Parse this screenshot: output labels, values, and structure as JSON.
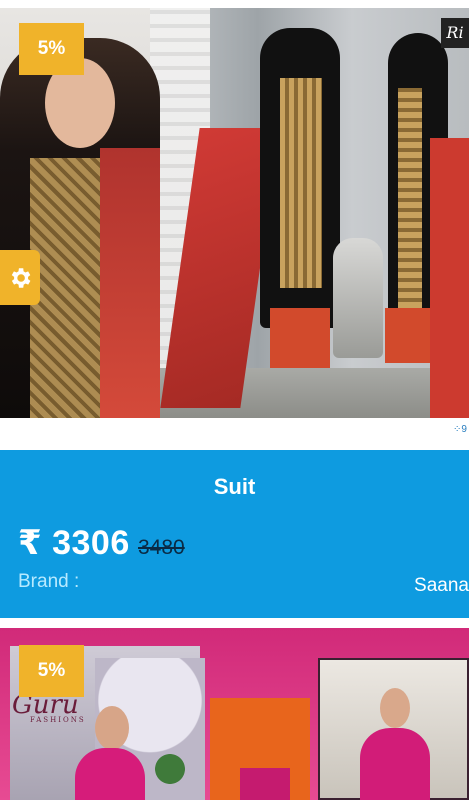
{
  "product1": {
    "discount_badge": "5%",
    "photo_logo_text": "Ri",
    "watermark_text": "⁘9",
    "title": "Suit",
    "price": "₹ 3306",
    "original_price": "3480",
    "brand_label": "Brand :",
    "brand_value": "Saana"
  },
  "product2": {
    "discount_badge": "5%",
    "photo_logo_text": "Guru",
    "photo_logo_sub": "FASHIONS"
  },
  "settings_tab": {
    "icon": "gear-icon"
  },
  "colors": {
    "accent_blue": "#0e9be0",
    "badge_yellow": "#f0b32a",
    "brand_label": "#b7eaff"
  }
}
